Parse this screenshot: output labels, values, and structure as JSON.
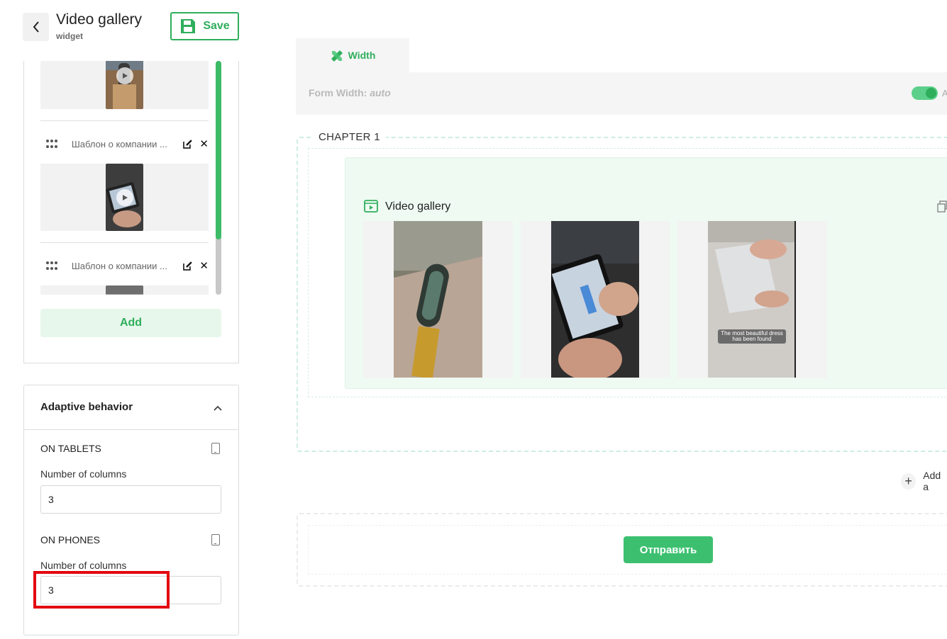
{
  "header": {
    "title": "Video gallery",
    "subtitle": "widget",
    "save_label": "Save"
  },
  "video_list": {
    "items": [
      {
        "label": "Шаблон о компании ..."
      },
      {
        "label": "Шаблон о компании ..."
      }
    ],
    "add_label": "Add"
  },
  "adaptive": {
    "heading": "Adaptive behavior",
    "tablets": {
      "title": "ON TABLETS",
      "field_label": "Number of columns",
      "value": "3"
    },
    "phones": {
      "title": "ON PHONES",
      "field_label": "Number of columns",
      "value": "3"
    }
  },
  "canvas": {
    "tab_label": "Width",
    "form_width_label": "Form Width:",
    "form_width_value": "auto",
    "toggle_cut_text": "A",
    "toggle_on": true,
    "chapter_title": "CHAPTER 1",
    "widget_title": "Video gallery",
    "video3_caption": "The most beautiful dress has been found",
    "add_chapter_label": "Add a",
    "submit_label": "Отправить"
  },
  "colors": {
    "accent": "#2fae5c",
    "highlight": "#e3060f"
  }
}
